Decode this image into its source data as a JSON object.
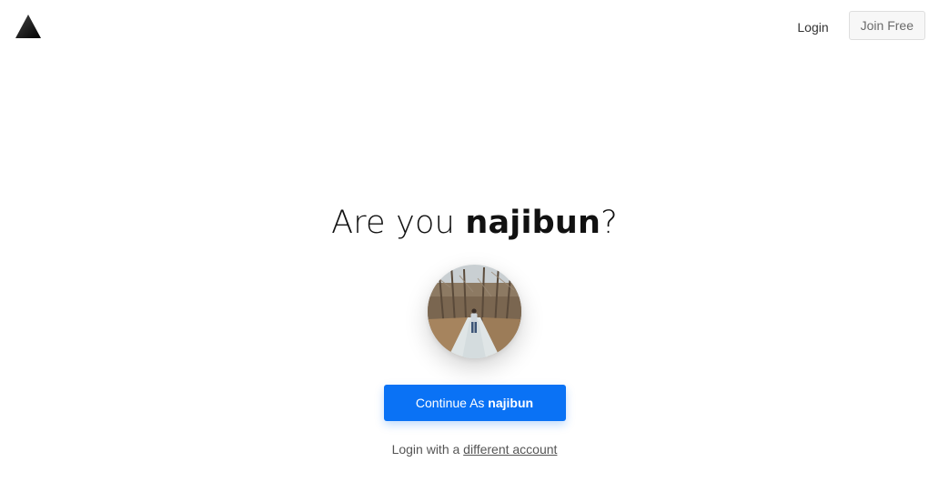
{
  "header": {
    "login_label": "Login",
    "join_label": "Join Free",
    "logo_icon": "triangle-logo-icon"
  },
  "main": {
    "heading_prefix": "Are you ",
    "username": "najibun",
    "heading_suffix": "?",
    "avatar_icon": "user-avatar-photo",
    "continue_prefix": "Continue As ",
    "continue_username": "najibun",
    "alt_prefix": "Login with a ",
    "alt_link": "different account"
  },
  "colors": {
    "primary_button": "#0a72f5",
    "text": "#111111",
    "muted_text": "#555555"
  }
}
